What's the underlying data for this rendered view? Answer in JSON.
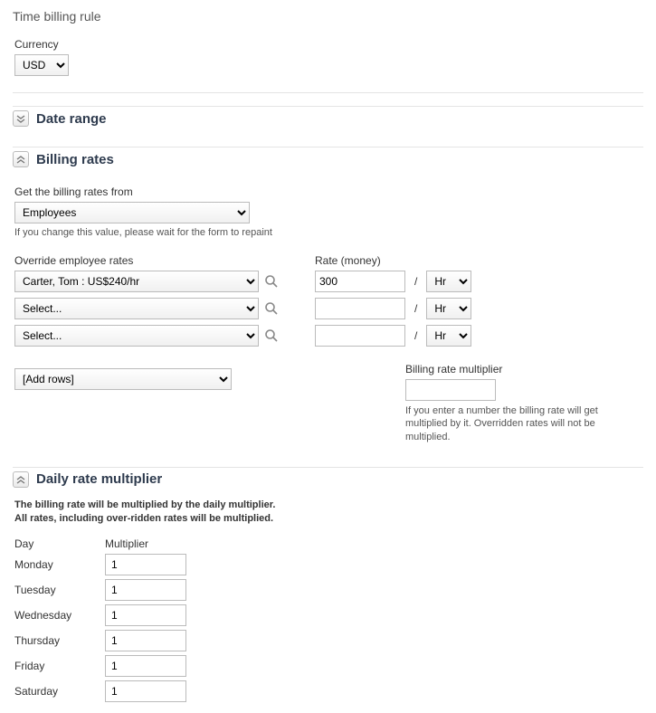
{
  "title": "Time billing rule",
  "currency": {
    "label": "Currency",
    "value": "USD"
  },
  "sections": {
    "date_range": {
      "title": "Date range",
      "collapsed": true
    },
    "billing_rates": {
      "title": "Billing rates",
      "from_label": "Get the billing rates from",
      "from_value": "Employees",
      "from_hint": "If you change this value, please wait for the form to repaint",
      "override_label": "Override employee rates",
      "rate_label": "Rate (money)",
      "rows": [
        {
          "override": "Carter, Tom : US$240/hr",
          "rate": "300",
          "unit": "Hr"
        },
        {
          "override": "Select...",
          "rate": "",
          "unit": "Hr"
        },
        {
          "override": "Select...",
          "rate": "",
          "unit": "Hr"
        }
      ],
      "add_rows": "[Add rows]",
      "multiplier_label": "Billing rate multiplier",
      "multiplier_value": "",
      "multiplier_hint": "If you enter a number the billing rate will get multiplied by it. Overridden rates will not be multiplied."
    },
    "daily": {
      "title": "Daily rate multiplier",
      "hint_line1": "The billing rate will be multiplied by the daily multiplier.",
      "hint_line2": "All rates, including over-ridden rates will be multiplied.",
      "day_header": "Day",
      "mult_header": "Multiplier",
      "rows": [
        {
          "day": "Monday",
          "value": "1"
        },
        {
          "day": "Tuesday",
          "value": "1"
        },
        {
          "day": "Wednesday",
          "value": "1"
        },
        {
          "day": "Thursday",
          "value": "1"
        },
        {
          "day": "Friday",
          "value": "1"
        },
        {
          "day": "Saturday",
          "value": "1"
        }
      ]
    }
  },
  "glyphs": {
    "collapsed": "≈",
    "expanded": "≈"
  }
}
